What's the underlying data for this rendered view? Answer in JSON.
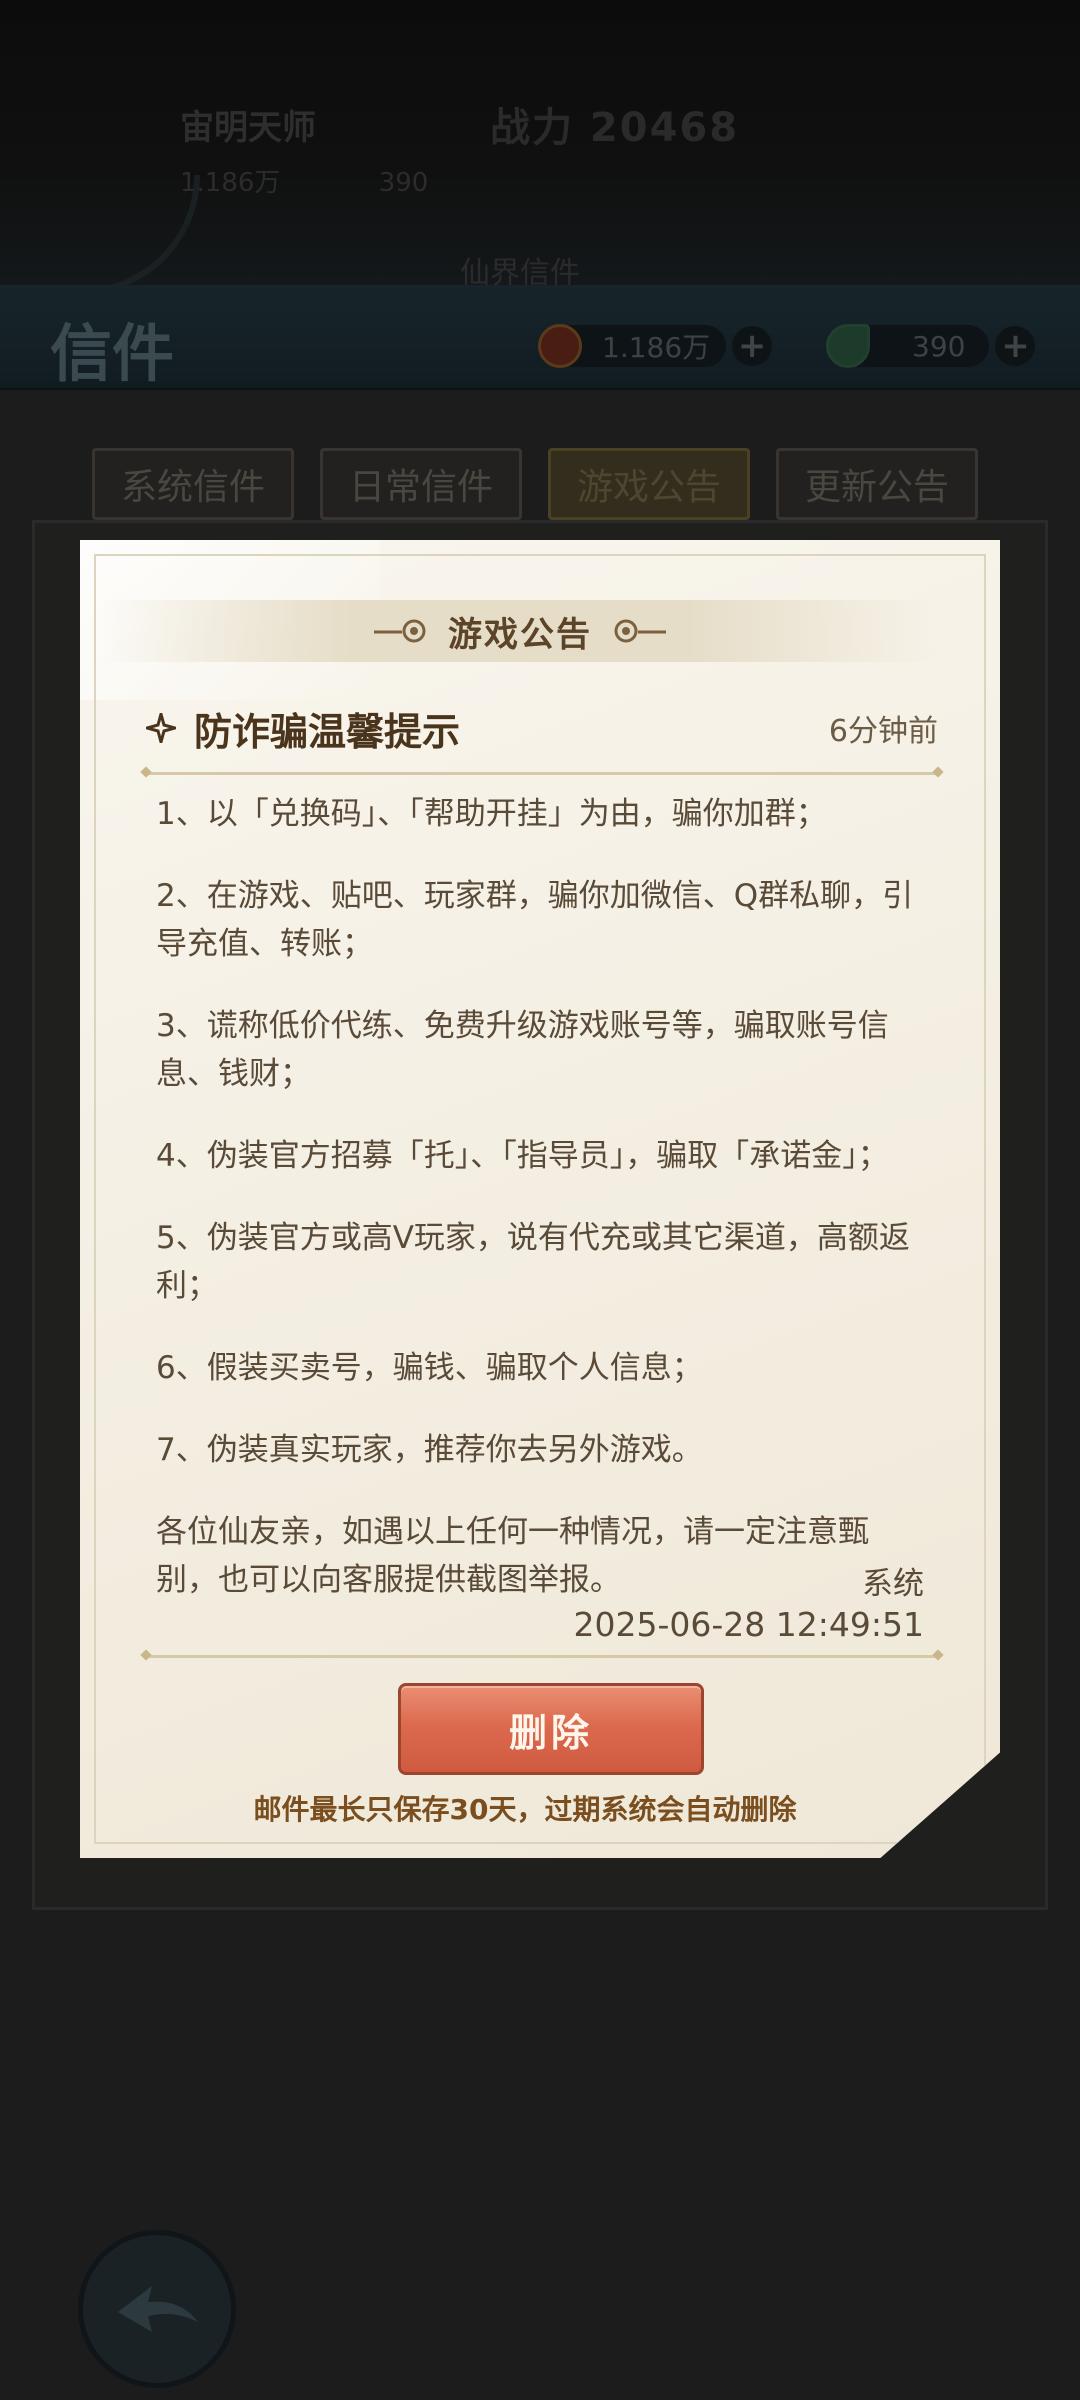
{
  "background": {
    "player_name": "宙明天师",
    "power_label": "战力 20468",
    "stat_1": "1.186万",
    "stat_2": "390",
    "sub_text": "仙界信件"
  },
  "header": {
    "title": "信件",
    "currency": [
      {
        "icon": "coin-icon",
        "value": "1.186万"
      },
      {
        "icon": "jade-icon",
        "value": "390"
      }
    ]
  },
  "tabs": [
    {
      "label": "系统信件",
      "active": false
    },
    {
      "label": "日常信件",
      "active": false
    },
    {
      "label": "游戏公告",
      "active": true
    },
    {
      "label": "更新公告",
      "active": false
    }
  ],
  "popup": {
    "title": "游戏公告",
    "notice_title": "防诈骗温馨提示",
    "notice_time": "6分钟前",
    "paragraphs": [
      "1、以「兑换码」、「帮助开挂」为由，骗你加群；",
      "2、在游戏、贴吧、玩家群，骗你加微信、Q群私聊，引导充值、转账；",
      "3、谎称低价代练、免费升级游戏账号等，骗取账号信息、钱财；",
      "4、伪装官方招募「托」、「指导员」，骗取「承诺金」；",
      "5、伪装官方或高V玩家，说有代充或其它渠道，高额返利；",
      "6、假装买卖号，骗钱、骗取个人信息；",
      "7、伪装真实玩家，推荐你去另外游戏。",
      "各位仙友亲，如遇以上任何一种情况，请一定注意甄别，也可以向客服提供截图举报。"
    ],
    "sender": "系统",
    "send_time": "2025-06-28 12:49:51",
    "delete_label": "删除",
    "footer_note": "邮件最长只保存30天，过期系统会自动删除"
  },
  "colors": {
    "paper": "#f4efe3",
    "delete_button": "#dc6a4f",
    "footer_note": "#7a4e1e",
    "text": "#5a4a38"
  }
}
